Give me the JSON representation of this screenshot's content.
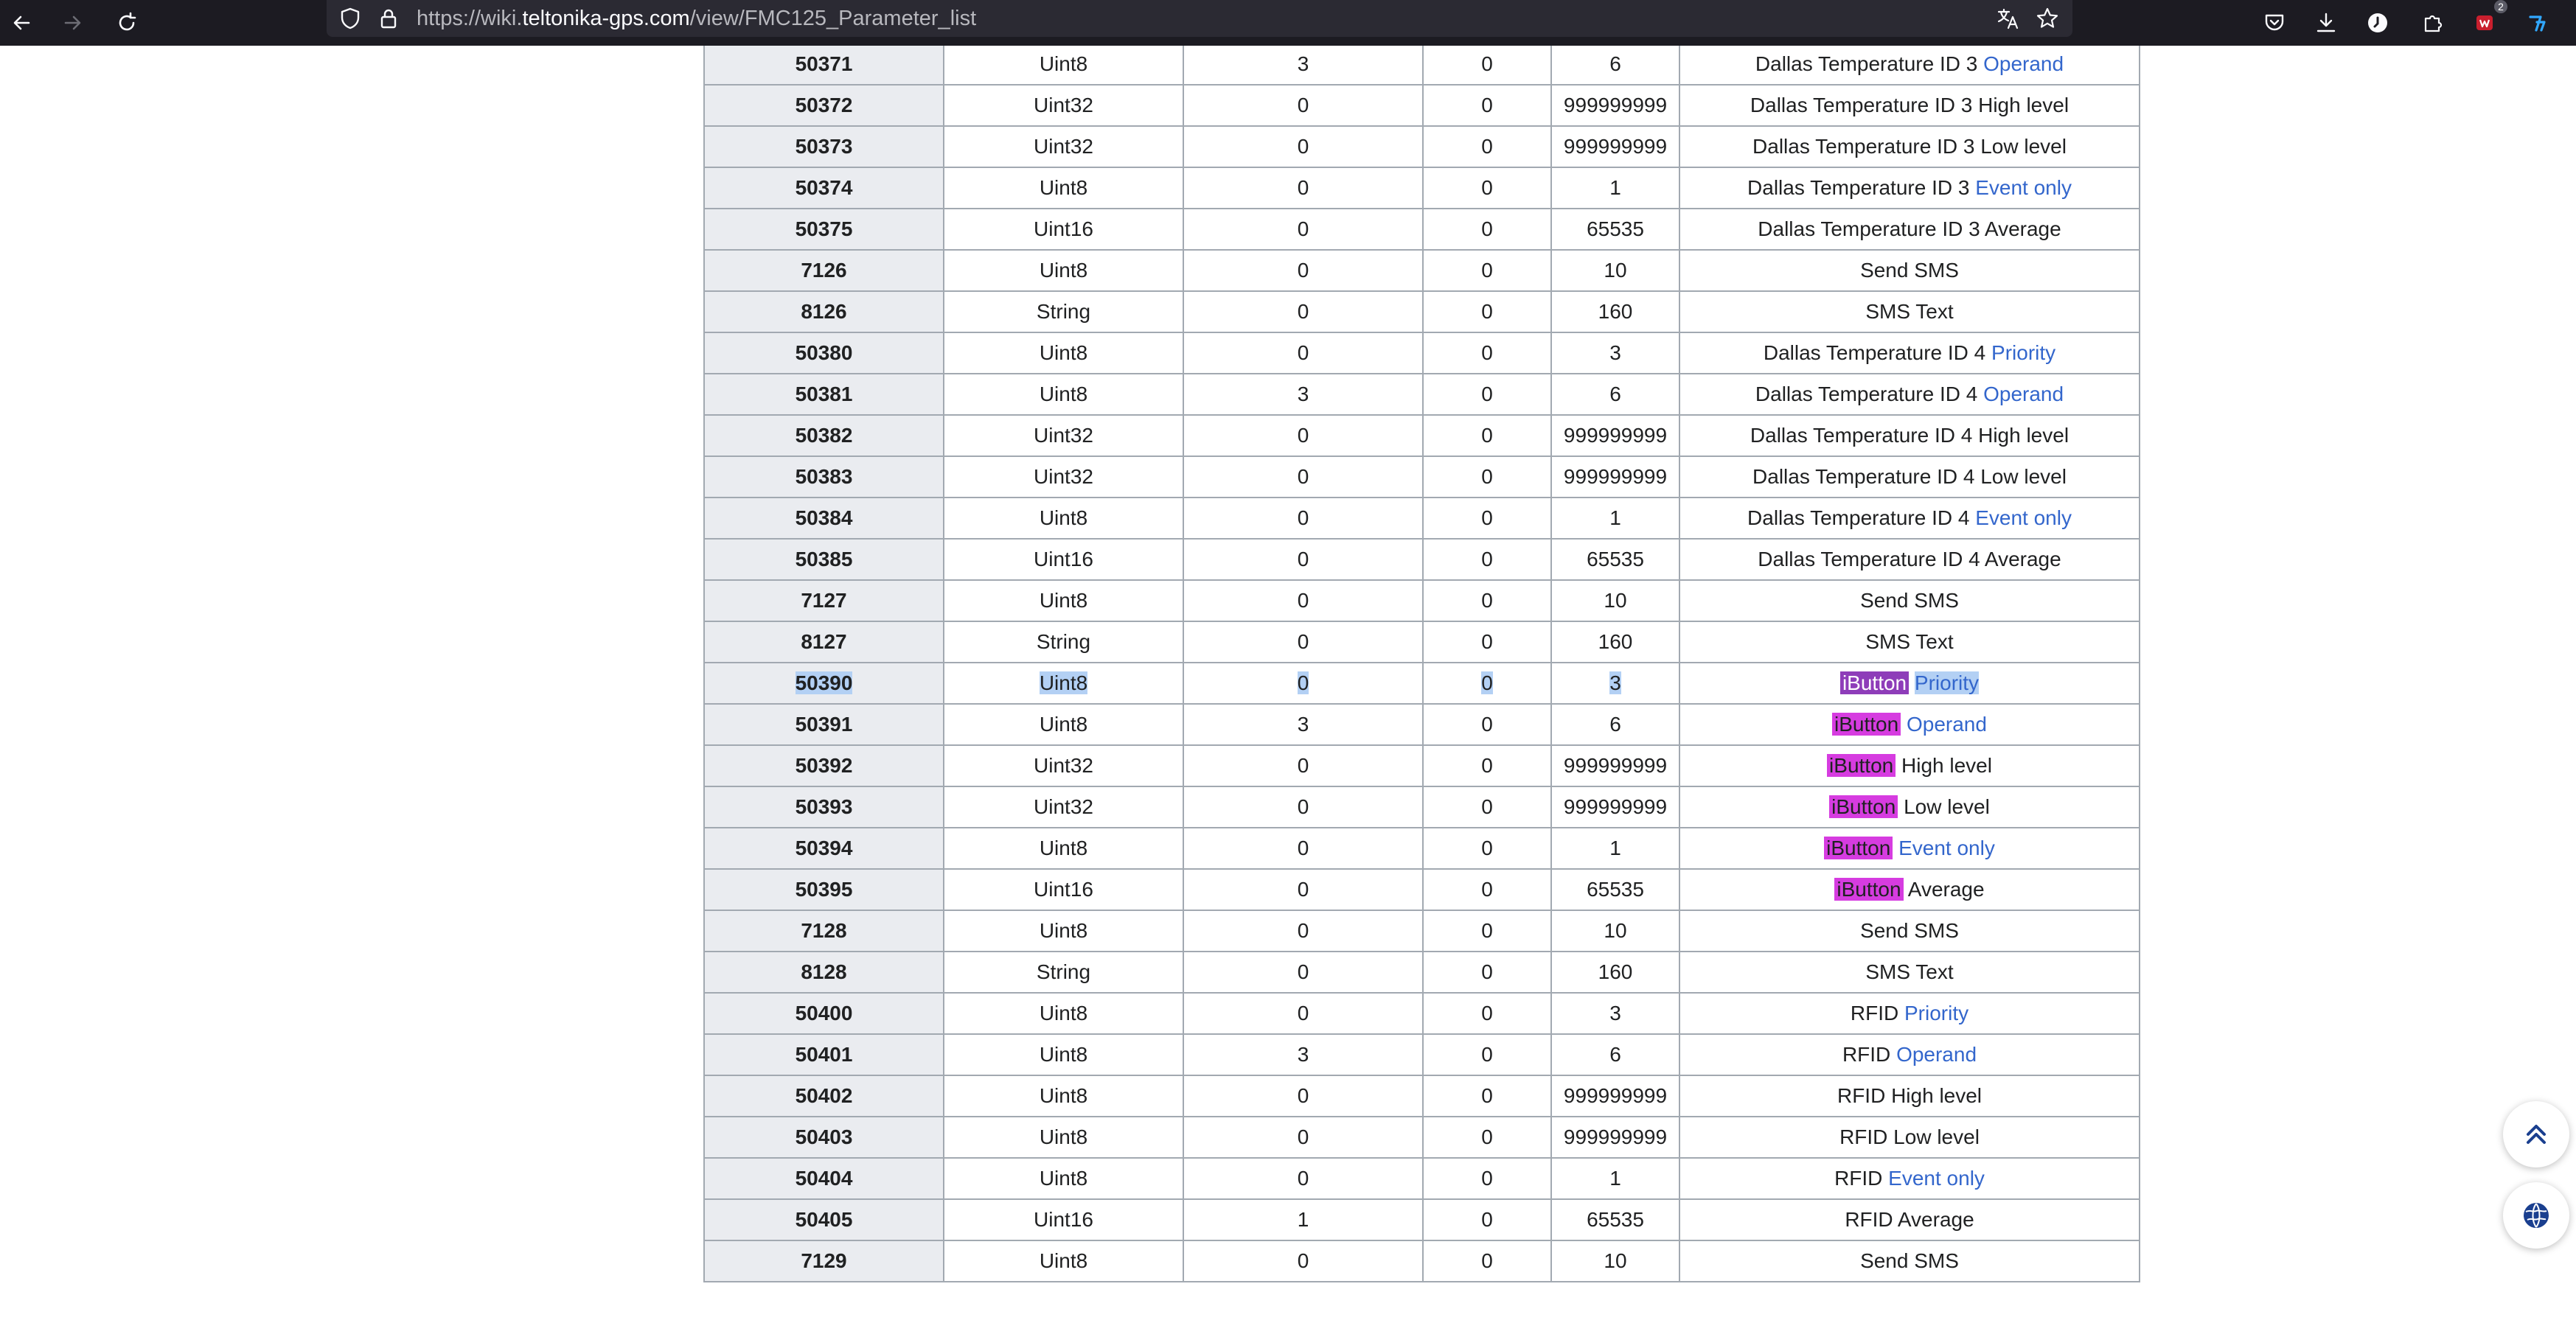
{
  "browser": {
    "url_prefix": "https://wiki.",
    "url_domain": "teltonika-gps.com",
    "url_path": "/view/FMC125_Parameter_list",
    "downloads_badge": "2",
    "icons": [
      "back-arrow-icon",
      "forward-arrow-icon",
      "reload-icon",
      "shield-icon",
      "lock-icon",
      "translate-icon",
      "star-icon",
      "pocket-icon",
      "download-icon",
      "account-icon",
      "extensions-icon",
      "addon-icon",
      "addon-icon-2"
    ]
  },
  "highlight_color": "#d63ce0",
  "highlight_active_color": "#8e3db9",
  "selection_color": "#b3d0f4",
  "link_color": "#3366cc",
  "rows": [
    {
      "id": "50371",
      "type": "Uint8",
      "default": "3",
      "min": "0",
      "max": "6",
      "desc": "Dallas Temperature ID 3",
      "suffix": "Operand",
      "suffix_link": true
    },
    {
      "id": "50372",
      "type": "Uint32",
      "default": "0",
      "min": "0",
      "max": "999999999",
      "desc": "Dallas Temperature ID 3 High level",
      "suffix": "",
      "suffix_link": false
    },
    {
      "id": "50373",
      "type": "Uint32",
      "default": "0",
      "min": "0",
      "max": "999999999",
      "desc": "Dallas Temperature ID 3 Low level",
      "suffix": "",
      "suffix_link": false
    },
    {
      "id": "50374",
      "type": "Uint8",
      "default": "0",
      "min": "0",
      "max": "1",
      "desc": "Dallas Temperature ID 3",
      "suffix": "Event only",
      "suffix_link": true
    },
    {
      "id": "50375",
      "type": "Uint16",
      "default": "0",
      "min": "0",
      "max": "65535",
      "desc": "Dallas Temperature ID 3 Average",
      "suffix": "",
      "suffix_link": false
    },
    {
      "id": "7126",
      "type": "Uint8",
      "default": "0",
      "min": "0",
      "max": "10",
      "desc": "Send SMS",
      "suffix": "",
      "suffix_link": false
    },
    {
      "id": "8126",
      "type": "String",
      "default": "0",
      "min": "0",
      "max": "160",
      "desc": "SMS Text",
      "suffix": "",
      "suffix_link": false
    },
    {
      "id": "50380",
      "type": "Uint8",
      "default": "0",
      "min": "0",
      "max": "3",
      "desc": "Dallas Temperature ID 4",
      "suffix": "Priority",
      "suffix_link": true
    },
    {
      "id": "50381",
      "type": "Uint8",
      "default": "3",
      "min": "0",
      "max": "6",
      "desc": "Dallas Temperature ID 4",
      "suffix": "Operand",
      "suffix_link": true
    },
    {
      "id": "50382",
      "type": "Uint32",
      "default": "0",
      "min": "0",
      "max": "999999999",
      "desc": "Dallas Temperature ID 4 High level",
      "suffix": "",
      "suffix_link": false
    },
    {
      "id": "50383",
      "type": "Uint32",
      "default": "0",
      "min": "0",
      "max": "999999999",
      "desc": "Dallas Temperature ID 4 Low level",
      "suffix": "",
      "suffix_link": false
    },
    {
      "id": "50384",
      "type": "Uint8",
      "default": "0",
      "min": "0",
      "max": "1",
      "desc": "Dallas Temperature ID 4",
      "suffix": "Event only",
      "suffix_link": true
    },
    {
      "id": "50385",
      "type": "Uint16",
      "default": "0",
      "min": "0",
      "max": "65535",
      "desc": "Dallas Temperature ID 4 Average",
      "suffix": "",
      "suffix_link": false
    },
    {
      "id": "7127",
      "type": "Uint8",
      "default": "0",
      "min": "0",
      "max": "10",
      "desc": "Send SMS",
      "suffix": "",
      "suffix_link": false
    },
    {
      "id": "8127",
      "type": "String",
      "default": "0",
      "min": "0",
      "max": "160",
      "desc": "SMS Text",
      "suffix": "",
      "suffix_link": false
    },
    {
      "id": "50390",
      "type": "Uint8",
      "default": "0",
      "min": "0",
      "max": "3",
      "desc": "iButton",
      "suffix": "Priority",
      "suffix_link": true,
      "selected": true,
      "highlight": "active"
    },
    {
      "id": "50391",
      "type": "Uint8",
      "default": "3",
      "min": "0",
      "max": "6",
      "desc": "iButton",
      "suffix": "Operand",
      "suffix_link": true,
      "highlight": "match"
    },
    {
      "id": "50392",
      "type": "Uint32",
      "default": "0",
      "min": "0",
      "max": "999999999",
      "desc": "iButton",
      "suffix": "High level",
      "suffix_link": false,
      "highlight": "match"
    },
    {
      "id": "50393",
      "type": "Uint32",
      "default": "0",
      "min": "0",
      "max": "999999999",
      "desc": "iButton",
      "suffix": "Low level",
      "suffix_link": false,
      "highlight": "match"
    },
    {
      "id": "50394",
      "type": "Uint8",
      "default": "0",
      "min": "0",
      "max": "1",
      "desc": "iButton",
      "suffix": "Event only",
      "suffix_link": true,
      "highlight": "match"
    },
    {
      "id": "50395",
      "type": "Uint16",
      "default": "0",
      "min": "0",
      "max": "65535",
      "desc": "iButton",
      "suffix": "Average",
      "suffix_link": false,
      "highlight": "match"
    },
    {
      "id": "7128",
      "type": "Uint8",
      "default": "0",
      "min": "0",
      "max": "10",
      "desc": "Send SMS",
      "suffix": "",
      "suffix_link": false
    },
    {
      "id": "8128",
      "type": "String",
      "default": "0",
      "min": "0",
      "max": "160",
      "desc": "SMS Text",
      "suffix": "",
      "suffix_link": false
    },
    {
      "id": "50400",
      "type": "Uint8",
      "default": "0",
      "min": "0",
      "max": "3",
      "desc": "RFID",
      "suffix": "Priority",
      "suffix_link": true
    },
    {
      "id": "50401",
      "type": "Uint8",
      "default": "3",
      "min": "0",
      "max": "6",
      "desc": "RFID",
      "suffix": "Operand",
      "suffix_link": true
    },
    {
      "id": "50402",
      "type": "Uint8",
      "default": "0",
      "min": "0",
      "max": "999999999",
      "desc": "RFID High level",
      "suffix": "",
      "suffix_link": false
    },
    {
      "id": "50403",
      "type": "Uint8",
      "default": "0",
      "min": "0",
      "max": "999999999",
      "desc": "RFID Low level",
      "suffix": "",
      "suffix_link": false
    },
    {
      "id": "50404",
      "type": "Uint8",
      "default": "0",
      "min": "0",
      "max": "1",
      "desc": "RFID",
      "suffix": "Event only",
      "suffix_link": true
    },
    {
      "id": "50405",
      "type": "Uint16",
      "default": "1",
      "min": "0",
      "max": "65535",
      "desc": "RFID Average",
      "suffix": "",
      "suffix_link": false
    },
    {
      "id": "7129",
      "type": "Uint8",
      "default": "0",
      "min": "0",
      "max": "10",
      "desc": "Send SMS",
      "suffix": "",
      "suffix_link": false
    }
  ],
  "floating": {
    "scroll_top_icon": "double-chevron-up-icon",
    "chat_icon": "globe-icon"
  }
}
